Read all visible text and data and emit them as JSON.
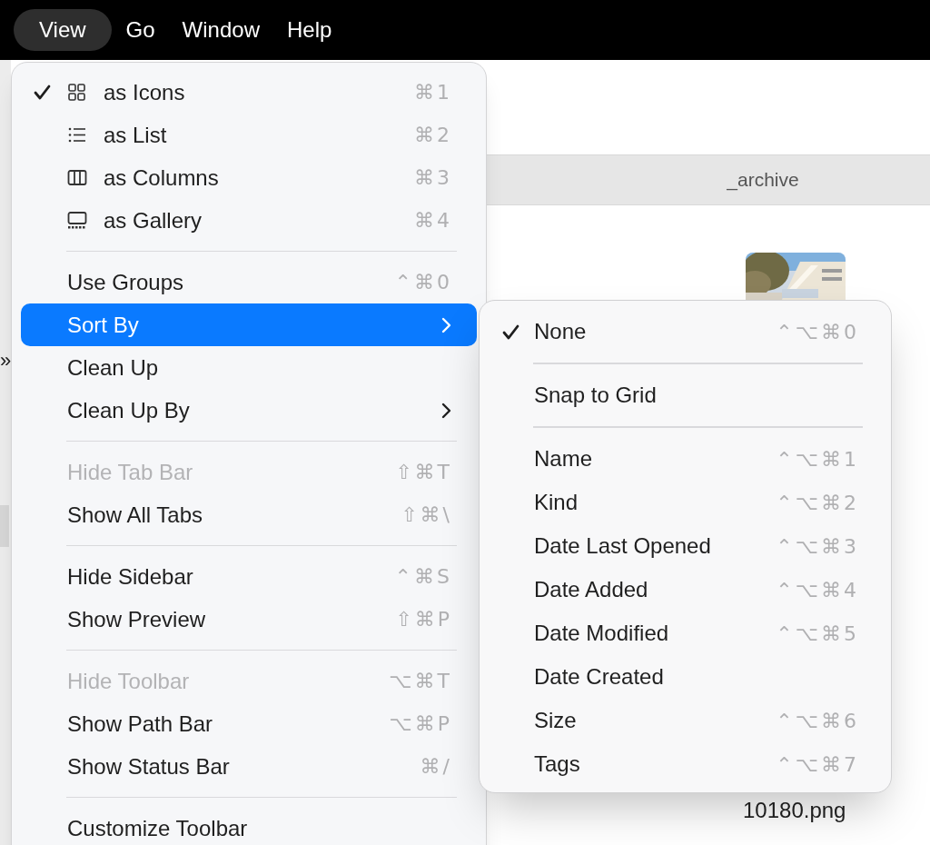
{
  "menu_bar": {
    "items": [
      {
        "label": "View",
        "selected": true
      },
      {
        "label": "Go",
        "selected": false
      },
      {
        "label": "Window",
        "selected": false
      },
      {
        "label": "Help",
        "selected": false
      }
    ]
  },
  "finder": {
    "path_bar": "_archive",
    "overflow_mark": "»",
    "file_name": "10180.png"
  },
  "view_menu": {
    "items": [
      {
        "kind": "view-mode",
        "label": "as Icons",
        "shortcut": "⌘1",
        "checked": true,
        "disabled": false,
        "selected": false,
        "has_submenu": false
      },
      {
        "kind": "view-mode",
        "label": "as List",
        "shortcut": "⌘2",
        "checked": false,
        "disabled": false,
        "selected": false,
        "has_submenu": false
      },
      {
        "kind": "view-mode",
        "label": "as Columns",
        "shortcut": "⌘3",
        "checked": false,
        "disabled": false,
        "selected": false,
        "has_submenu": false
      },
      {
        "kind": "view-mode",
        "label": "as Gallery",
        "shortcut": "⌘4",
        "checked": false,
        "disabled": false,
        "selected": false,
        "has_submenu": false
      },
      {
        "kind": "separator"
      },
      {
        "kind": "item",
        "label": "Use Groups",
        "shortcut": "⌃⌘0",
        "checked": false,
        "disabled": false,
        "selected": false,
        "has_submenu": false
      },
      {
        "kind": "item",
        "label": "Sort By",
        "checked": false,
        "disabled": false,
        "selected": true,
        "has_submenu": true
      },
      {
        "kind": "item",
        "label": "Clean Up",
        "checked": false,
        "disabled": false,
        "selected": false,
        "has_submenu": false
      },
      {
        "kind": "item",
        "label": "Clean Up By",
        "checked": false,
        "disabled": false,
        "selected": false,
        "has_submenu": true
      },
      {
        "kind": "separator"
      },
      {
        "kind": "item",
        "label": "Hide Tab Bar",
        "shortcut": "⇧⌘T",
        "checked": false,
        "disabled": true,
        "selected": false,
        "has_submenu": false
      },
      {
        "kind": "item",
        "label": "Show All Tabs",
        "shortcut": "⇧⌘\\",
        "checked": false,
        "disabled": false,
        "selected": false,
        "has_submenu": false
      },
      {
        "kind": "separator"
      },
      {
        "kind": "item",
        "label": "Hide Sidebar",
        "shortcut": "⌃⌘S",
        "checked": false,
        "disabled": false,
        "selected": false,
        "has_submenu": false
      },
      {
        "kind": "item",
        "label": "Show Preview",
        "shortcut": "⇧⌘P",
        "checked": false,
        "disabled": false,
        "selected": false,
        "has_submenu": false
      },
      {
        "kind": "separator"
      },
      {
        "kind": "item",
        "label": "Hide Toolbar",
        "shortcut": "⌥⌘T",
        "checked": false,
        "disabled": true,
        "selected": false,
        "has_submenu": false
      },
      {
        "kind": "item",
        "label": "Show Path Bar",
        "shortcut": "⌥⌘P",
        "checked": false,
        "disabled": false,
        "selected": false,
        "has_submenu": false
      },
      {
        "kind": "item",
        "label": "Show Status Bar",
        "shortcut": "⌘/",
        "checked": false,
        "disabled": false,
        "selected": false,
        "has_submenu": false
      },
      {
        "kind": "separator"
      },
      {
        "kind": "item",
        "label": "Customize Toolbar",
        "checked": false,
        "disabled": false,
        "selected": false,
        "has_submenu": false
      }
    ]
  },
  "sort_by_submenu": {
    "items": [
      {
        "kind": "item",
        "label": "None",
        "shortcut": "⌃⌥⌘0",
        "checked": true
      },
      {
        "kind": "separator"
      },
      {
        "kind": "item",
        "label": "Snap to Grid",
        "checked": false
      },
      {
        "kind": "separator"
      },
      {
        "kind": "item",
        "label": "Name",
        "shortcut": "⌃⌥⌘1",
        "checked": false
      },
      {
        "kind": "item",
        "label": "Kind",
        "shortcut": "⌃⌥⌘2",
        "checked": false
      },
      {
        "kind": "item",
        "label": "Date Last Opened",
        "shortcut": "⌃⌥⌘3",
        "checked": false
      },
      {
        "kind": "item",
        "label": "Date Added",
        "shortcut": "⌃⌥⌘4",
        "checked": false
      },
      {
        "kind": "item",
        "label": "Date Modified",
        "shortcut": "⌃⌥⌘5",
        "checked": false
      },
      {
        "kind": "item",
        "label": "Date Created",
        "checked": false
      },
      {
        "kind": "item",
        "label": "Size",
        "shortcut": "⌃⌥⌘6",
        "checked": false
      },
      {
        "kind": "item",
        "label": "Tags",
        "shortcut": "⌃⌥⌘7",
        "checked": false
      }
    ]
  }
}
